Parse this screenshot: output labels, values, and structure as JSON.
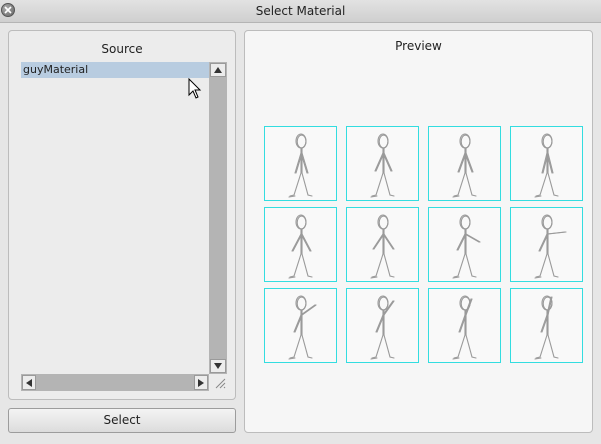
{
  "window": {
    "title": "Select Material"
  },
  "source": {
    "label": "Source",
    "items": [
      {
        "label": "guyMaterial",
        "selected": true
      }
    ]
  },
  "buttons": {
    "select_label": "Select"
  },
  "preview": {
    "label": "Preview",
    "frame_count": 12,
    "frame_icon": "stick-figure-icon"
  },
  "colors": {
    "selection": "#b8cce0",
    "frame_border": "#33dde0"
  }
}
